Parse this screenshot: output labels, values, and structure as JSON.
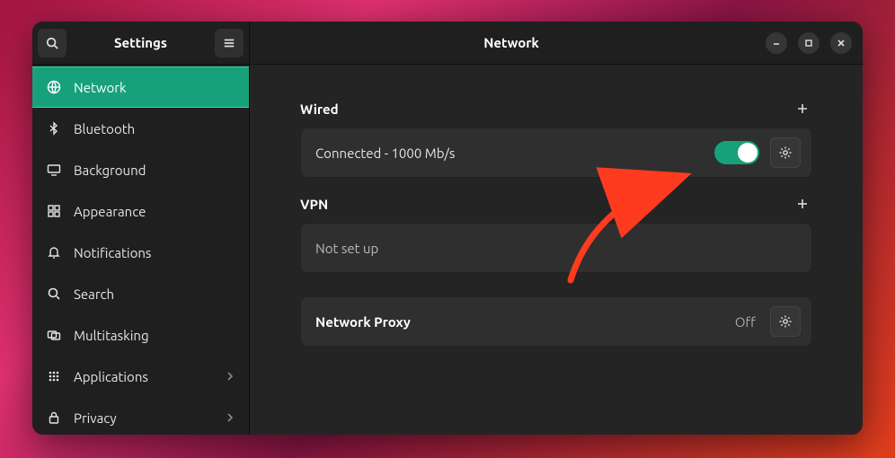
{
  "header": {
    "sidebar_title": "Settings",
    "main_title": "Network"
  },
  "sidebar": {
    "items": [
      {
        "id": "network",
        "label": "Network",
        "active": true
      },
      {
        "id": "bluetooth",
        "label": "Bluetooth",
        "active": false
      },
      {
        "id": "background",
        "label": "Background",
        "active": false
      },
      {
        "id": "appearance",
        "label": "Appearance",
        "active": false
      },
      {
        "id": "notifications",
        "label": "Notifications",
        "active": false
      },
      {
        "id": "search",
        "label": "Search",
        "active": false
      },
      {
        "id": "multitasking",
        "label": "Multitasking",
        "active": false
      },
      {
        "id": "applications",
        "label": "Applications",
        "active": false,
        "has_chevron": true
      },
      {
        "id": "privacy",
        "label": "Privacy",
        "active": false,
        "has_chevron": true
      }
    ]
  },
  "sections": {
    "wired": {
      "title": "Wired",
      "status": "Connected - 1000 Mb/s",
      "toggle_on": true
    },
    "vpn": {
      "title": "VPN",
      "status": "Not set up"
    },
    "proxy": {
      "title": "Network Proxy",
      "value": "Off"
    }
  },
  "colors": {
    "accent": "#17a17a",
    "window_bg": "#242424",
    "sidebar_bg": "#1f1f1f",
    "panel_bg": "#2f2f2f"
  }
}
